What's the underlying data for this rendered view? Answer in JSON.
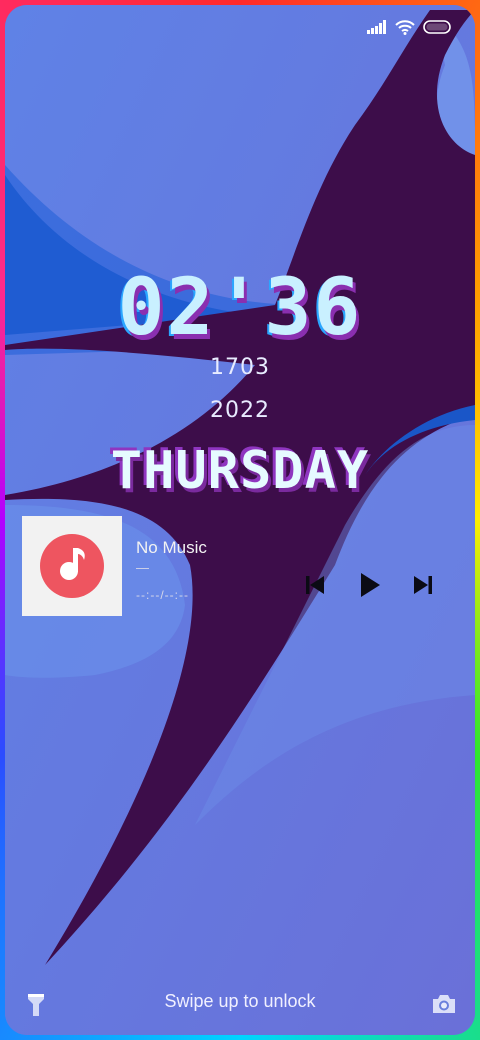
{
  "lockscreen": {
    "time": "02'36",
    "date_line1": "1703",
    "date_line2": "2022",
    "day": "THURSDAY",
    "unlock_hint": "Swipe up to unlock"
  },
  "music": {
    "title": "No Music",
    "artist": "—",
    "time": "--:--/--:--"
  },
  "status_icons": [
    "signal-icon",
    "wifi-icon",
    "battery-icon"
  ],
  "colors": {
    "background": "#5b7be0",
    "dark_shape": "#3d0d4a",
    "accent_red": "#ee5560",
    "time_shadow": "#8a2fb0"
  }
}
